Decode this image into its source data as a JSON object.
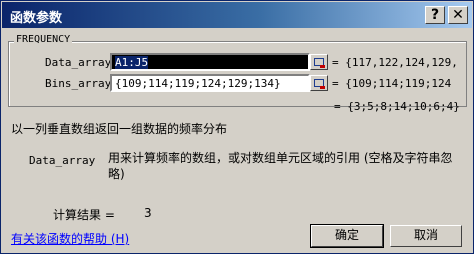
{
  "window": {
    "title": "函数参数",
    "help_glyph": "?",
    "close_glyph": "✕"
  },
  "function": {
    "name": "FREQUENCY"
  },
  "args": [
    {
      "label": "Data_array",
      "value": "A1:J5",
      "preview": "= {117,122,124,129,"
    },
    {
      "label": "Bins_array",
      "value": "{109;114;119;124;129;134}",
      "preview": "= {109;114;119;124"
    }
  ],
  "result_preview": "= {3;5;8;14;10;6;4}",
  "description": "以一列垂直数组返回一组数据的频率分布",
  "arg_help": {
    "name": "Data_array",
    "text": "用来计算频率的数组，或对数组单元区域的引用 (空格及字符串忽略)"
  },
  "result": {
    "label": "计算结果 =",
    "value": "3"
  },
  "help_link": "有关该函数的帮助 (H)",
  "buttons": {
    "ok": "确定",
    "cancel": "取消"
  }
}
